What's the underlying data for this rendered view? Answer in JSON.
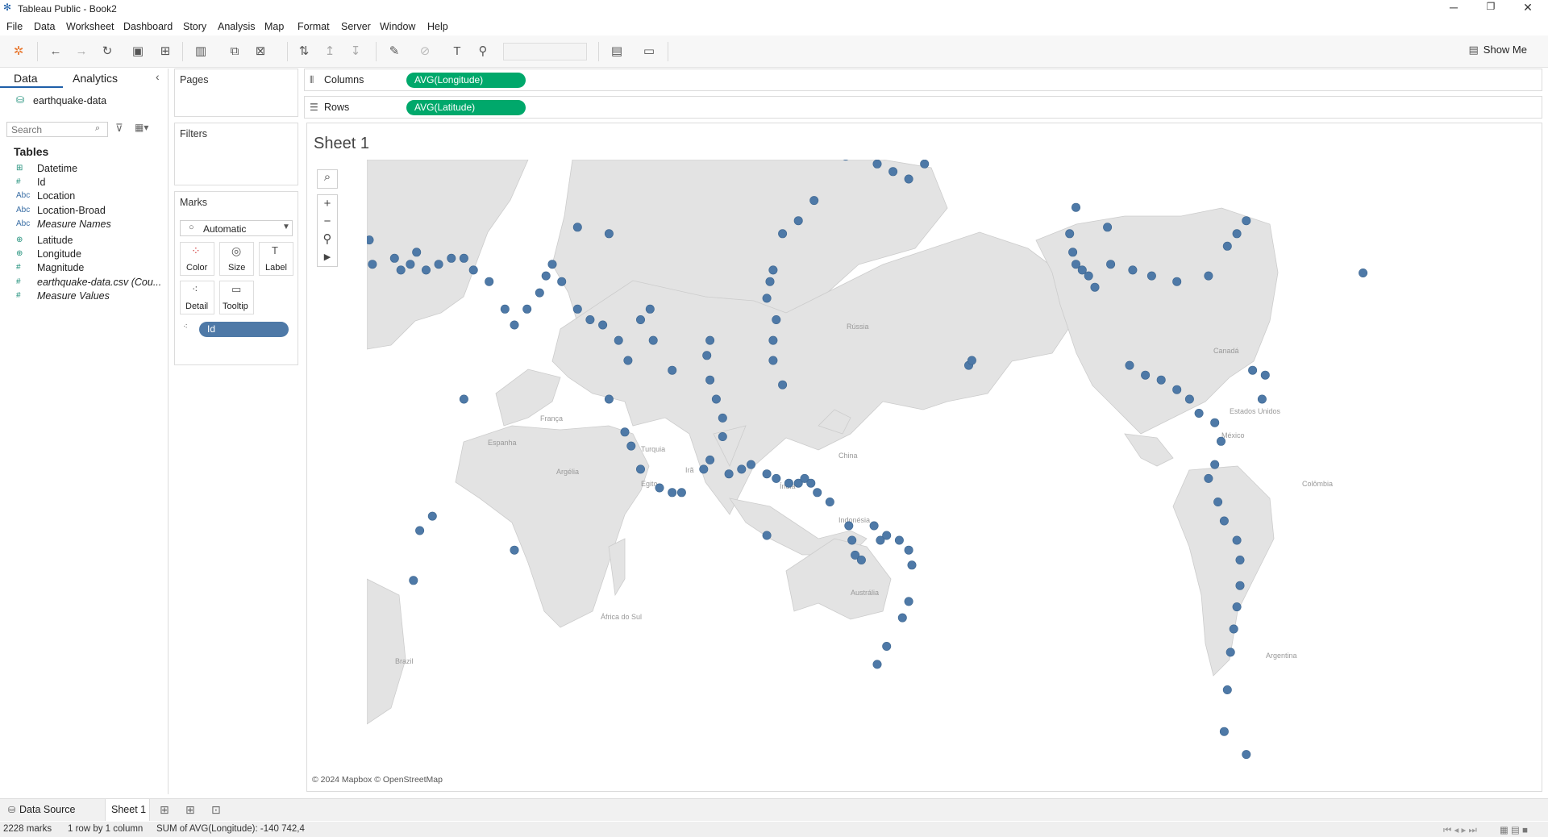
{
  "window": {
    "title": "Tableau Public - Book2",
    "controls": {
      "minimize": "─",
      "maximize": "❐",
      "close": "✕"
    }
  },
  "menu": [
    "File",
    "Data",
    "Worksheet",
    "Dashboard",
    "Story",
    "Analysis",
    "Map",
    "Format",
    "Server",
    "Window",
    "Help"
  ],
  "toolbar": {
    "show_me": "Show Me"
  },
  "left_panel": {
    "tab_data": "Data",
    "tab_analytics": "Analytics",
    "datasource": "earthquake-data",
    "search_placeholder": "Search",
    "tables_heading": "Tables",
    "fields": [
      {
        "icon": "⊞",
        "name": "Datetime",
        "italic": false
      },
      {
        "icon": "#",
        "name": "Id",
        "italic": false
      },
      {
        "icon": "Abc",
        "name": "Location",
        "italic": false
      },
      {
        "icon": "Abc",
        "name": "Location-Broad",
        "italic": false
      },
      {
        "icon": "Abc",
        "name": "Measure Names",
        "italic": true
      },
      {
        "icon": "⊕",
        "name": "Latitude",
        "italic": false
      },
      {
        "icon": "⊕",
        "name": "Longitude",
        "italic": false
      },
      {
        "icon": "#",
        "name": "Magnitude",
        "italic": false
      },
      {
        "icon": "#",
        "name": "earthquake-data.csv (Cou...",
        "italic": true
      },
      {
        "icon": "#",
        "name": "Measure Values",
        "italic": true
      }
    ]
  },
  "cards": {
    "pages": "Pages",
    "filters": "Filters",
    "marks": "Marks",
    "mark_type": "Automatic",
    "mark_buttons": [
      "Color",
      "Size",
      "Label",
      "Detail",
      "Tooltip"
    ],
    "detail_pill": "Id"
  },
  "shelves": {
    "columns_label": "Columns",
    "columns_pill": "AVG(Longitude)",
    "rows_label": "Rows",
    "rows_pill": "AVG(Latitude)"
  },
  "sheet": {
    "title": "Sheet 1",
    "attribution": "© 2024 Mapbox © OpenStreetMap",
    "map_labels": [
      "Rússia",
      "Canadá",
      "Estados Unidos",
      "México",
      "Colômbia",
      "Brazil",
      "Argentina",
      "França",
      "Espanha",
      "Turquia",
      "Irã",
      "Egito",
      "Argélia",
      "Índia",
      "China",
      "Indonésia",
      "Austrália",
      "África do Sul"
    ]
  },
  "colors": {
    "mark": "#4e79a7",
    "pill": "#00a86b",
    "land": "#e3e3e3"
  },
  "bottom": {
    "data_source_tab": "Data Source",
    "sheet_tab": "Sheet 1"
  },
  "status": {
    "marks": "2228 marks",
    "layout": "1 row by 1 column",
    "sum": "SUM of AVG(Longitude): -140 742,4"
  },
  "chart_data": {
    "type": "scatter",
    "title": "Sheet 1",
    "xlabel": "AVG(Longitude)",
    "ylabel": "AVG(Latitude)",
    "series": [
      {
        "name": "Id",
        "points": [
          [
            -31,
            36.5
          ],
          [
            -25,
            63
          ],
          [
            -51,
            58
          ],
          [
            -48,
            80
          ],
          [
            80,
            68
          ],
          [
            165,
            54
          ],
          [
            175,
            53
          ],
          [
            180,
            52
          ],
          [
            -175,
            51
          ],
          [
            -170,
            53
          ],
          [
            -160,
            55
          ],
          [
            -155,
            59
          ],
          [
            -150,
            61
          ],
          [
            -148,
            60
          ],
          [
            -140,
            59
          ],
          [
            -135,
            57
          ],
          [
            155,
            48
          ],
          [
            150,
            45
          ],
          [
            145,
            43
          ],
          [
            142,
            37
          ],
          [
            141,
            35
          ],
          [
            140,
            32
          ],
          [
            143,
            28
          ],
          [
            142,
            24
          ],
          [
            142,
            20
          ],
          [
            145,
            15
          ],
          [
            122,
            24
          ],
          [
            121,
            21
          ],
          [
            122,
            16
          ],
          [
            124,
            12
          ],
          [
            126,
            8
          ],
          [
            126,
            4
          ],
          [
            122,
            -1
          ],
          [
            120,
            -3
          ],
          [
            113,
            -8
          ],
          [
            110,
            -8
          ],
          [
            106,
            -7
          ],
          [
            100,
            -3
          ],
          [
            97,
            2
          ],
          [
            95,
            5
          ],
          [
            128,
            -4
          ],
          [
            132,
            -3
          ],
          [
            135,
            -2
          ],
          [
            140,
            -4
          ],
          [
            143,
            -5
          ],
          [
            147,
            -6
          ],
          [
            150,
            -6
          ],
          [
            152,
            -5
          ],
          [
            154,
            -6
          ],
          [
            156,
            -8
          ],
          [
            160,
            -10
          ],
          [
            166,
            -15
          ],
          [
            167,
            -18
          ],
          [
            168,
            -21
          ],
          [
            170,
            -22
          ],
          [
            174,
            -15
          ],
          [
            176,
            -18
          ],
          [
            178,
            -17
          ],
          [
            -178,
            -18
          ],
          [
            -175,
            -20
          ],
          [
            -174,
            -23
          ],
          [
            -175,
            -30
          ],
          [
            -177,
            -33
          ],
          [
            178,
            -38
          ],
          [
            175,
            -41
          ],
          [
            -116,
            34
          ],
          [
            -118,
            36
          ],
          [
            -120,
            37
          ],
          [
            -122,
            38
          ],
          [
            -123,
            40
          ],
          [
            -124,
            43
          ],
          [
            -122,
            47
          ],
          [
            -112,
            44
          ],
          [
            -111,
            38
          ],
          [
            -104,
            37
          ],
          [
            -98,
            36
          ],
          [
            -90,
            35
          ],
          [
            -80,
            36
          ],
          [
            -74,
            41
          ],
          [
            -71,
            43
          ],
          [
            -68,
            45
          ],
          [
            -105,
            19
          ],
          [
            -100,
            17
          ],
          [
            -95,
            16
          ],
          [
            -90,
            14
          ],
          [
            -86,
            12
          ],
          [
            -83,
            9
          ],
          [
            -78,
            7
          ],
          [
            -76,
            3
          ],
          [
            -78,
            -2
          ],
          [
            -80,
            -5
          ],
          [
            -77,
            -10
          ],
          [
            -75,
            -14
          ],
          [
            -71,
            -18
          ],
          [
            -70,
            -22
          ],
          [
            -70,
            -27
          ],
          [
            -71,
            -31
          ],
          [
            -72,
            -35
          ],
          [
            -73,
            -39
          ],
          [
            -74,
            -45
          ],
          [
            -75,
            -51
          ],
          [
            -68,
            -54
          ],
          [
            -63,
            12
          ],
          [
            -62,
            17
          ],
          [
            -66,
            18
          ],
          [
            -156,
            19
          ],
          [
            -155,
            20
          ],
          [
            15,
            38
          ],
          [
            14,
            42
          ],
          [
            22,
            39
          ],
          [
            24,
            37
          ],
          [
            27,
            38
          ],
          [
            29,
            40
          ],
          [
            32,
            37
          ],
          [
            36,
            38
          ],
          [
            40,
            39
          ],
          [
            44,
            39
          ],
          [
            47,
            37
          ],
          [
            52,
            35
          ],
          [
            57,
            30
          ],
          [
            60,
            27
          ],
          [
            64,
            30
          ],
          [
            68,
            33
          ],
          [
            70,
            36
          ],
          [
            72,
            38
          ],
          [
            75,
            35
          ],
          [
            80,
            30
          ],
          [
            84,
            28
          ],
          [
            88,
            27
          ],
          [
            93,
            24
          ],
          [
            96,
            20
          ],
          [
            100,
            28
          ],
          [
            103,
            30
          ],
          [
            104,
            24
          ],
          [
            90,
            43
          ],
          [
            80,
            44
          ],
          [
            -3,
            35
          ],
          [
            -7,
            33
          ],
          [
            6,
            36
          ],
          [
            10,
            34
          ],
          [
            -3,
            40
          ],
          [
            34,
            -13
          ],
          [
            30,
            -16
          ],
          [
            28,
            -26
          ],
          [
            44,
            12
          ],
          [
            60,
            -20
          ],
          [
            -12,
            -15
          ],
          [
            90,
            12
          ],
          [
            110,
            18
          ],
          [
            140,
            -17
          ]
        ]
      }
    ],
    "xlim": [
      -180,
      180
    ],
    "ylim": [
      -60,
      85
    ],
    "grid": false,
    "legend": "none"
  }
}
